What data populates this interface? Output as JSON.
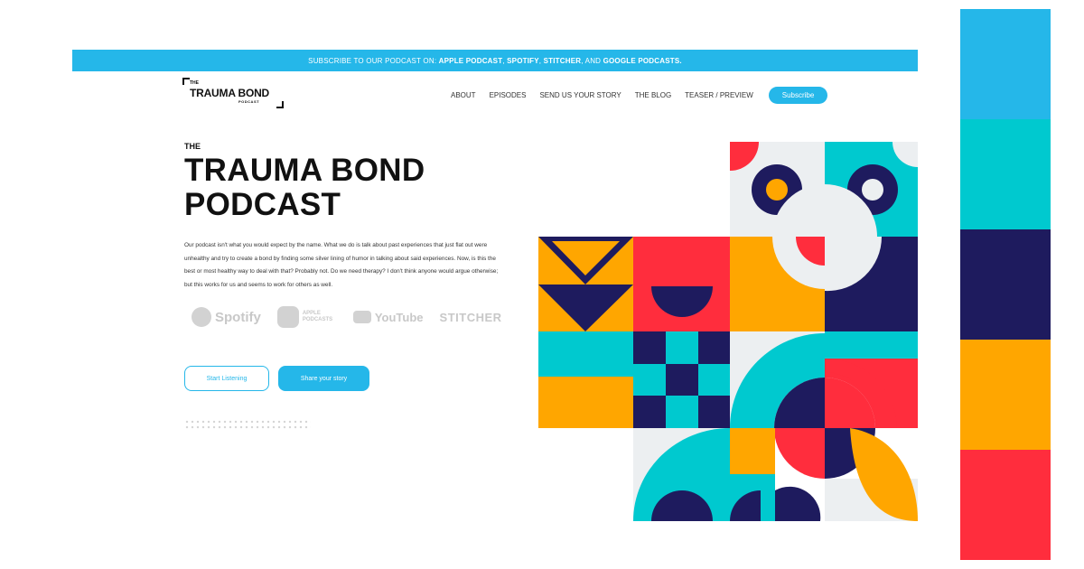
{
  "banner": {
    "prefix": "SUBSCRIBE TO OUR PODCAST ON: ",
    "apple": "APPLE PODCAST",
    "sep1": ", ",
    "spotify": "SPOTIFY",
    "sep2": ", ",
    "stitcher": "STITCHER",
    "sep3": ", AND ",
    "google": "GOOGLE PODCASTS",
    "end": "."
  },
  "logo": {
    "the": "THE",
    "main": "TRAUMA BOND",
    "sub": "PODCAST"
  },
  "nav": {
    "items": [
      "ABOUT",
      "EPISODES",
      "SEND US YOUR STORY",
      "THE BLOG",
      "TEASER / PREVIEW"
    ],
    "subscribe": "Subscribe"
  },
  "hero": {
    "eyebrow": "THE",
    "title_line1": "TRAUMA BOND",
    "title_line2": "PODCAST",
    "description": "Our podcast isn't what you would expect by the name. What we do is talk about past experiences that just flat out were unhealthy and try to create a bond by finding some silver lining of humor in talking about said experiences. Now, is this the best or most healthy way to deal with that? Probably not. Do we need therapy? I don't think anyone would argue otherwise; but this works for us and seems to work for others as well.",
    "start_button": "Start Listening",
    "share_button": "Share your story"
  },
  "platforms": [
    {
      "icon": "spotify-icon",
      "label": "Spotify"
    },
    {
      "icon": "apple-podcasts-icon",
      "label": "APPLE PODCASTS"
    },
    {
      "icon": "youtube-icon",
      "label": "YouTube"
    },
    {
      "icon": "stitcher-icon",
      "label": "STITCHER"
    }
  ],
  "colors": {
    "accent": "#25b7e9",
    "palette": [
      "#25b7e9",
      "#00c9cf",
      "#1e1b5e",
      "#ffa600",
      "#ff2d3d"
    ],
    "light": "#eceff1"
  }
}
